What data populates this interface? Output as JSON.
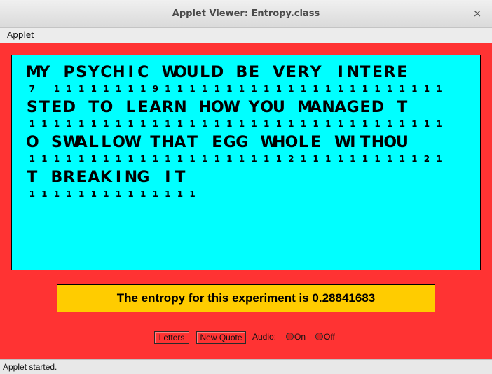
{
  "window": {
    "title": "Applet Viewer: Entropy.class",
    "close_symbol": "×"
  },
  "menu": {
    "items": [
      "Applet"
    ]
  },
  "quote_lines": [
    {
      "text": "MY PSYCHIC WOULD BE VERY INTERE",
      "counts": [
        "7",
        "",
        "1",
        "1",
        "1",
        "1",
        "1",
        "1",
        "1",
        "1",
        "9",
        "1",
        "1",
        "1",
        "1",
        "1",
        "1",
        "1",
        "1",
        "1",
        "1",
        "1",
        "1",
        "1",
        "1",
        "1",
        "1",
        "1",
        "1",
        "1",
        "1",
        "1",
        "1",
        "1"
      ]
    },
    {
      "text": "STED TO LEARN HOW YOU MANAGED T",
      "counts": [
        "1",
        "1",
        "1",
        "1",
        "1",
        "1",
        "1",
        "1",
        "1",
        "1",
        "1",
        "1",
        "1",
        "1",
        "1",
        "1",
        "1",
        "1",
        "1",
        "1",
        "1",
        "1",
        "1",
        "1",
        "1",
        "1",
        "1",
        "1",
        "1",
        "1",
        "1",
        "1",
        "1",
        "1"
      ]
    },
    {
      "text": "O SWALLOW THAT EGG WHOLE WITHOU",
      "counts": [
        "1",
        "1",
        "1",
        "1",
        "1",
        "1",
        "1",
        "1",
        "1",
        "1",
        "1",
        "1",
        "1",
        "1",
        "1",
        "1",
        "1",
        "1",
        "1",
        "1",
        "1",
        "2",
        "1",
        "1",
        "1",
        "1",
        "1",
        "1",
        "1",
        "1",
        "1",
        "1",
        "2",
        "1"
      ]
    },
    {
      "text": "T BREAKING IT",
      "counts": [
        "1",
        "1",
        "1",
        "1",
        "1",
        "1",
        "1",
        "1",
        "1",
        "1",
        "1",
        "1",
        "1",
        "1"
      ]
    }
  ],
  "entropy_text": "The entropy for this experiment is 0.28841683",
  "controls": {
    "letters_label": "Letters",
    "new_quote_label": "New Quote",
    "audio_label": "Audio:",
    "audio_on_label": "On",
    "audio_off_label": "Off"
  },
  "status": "Applet started.",
  "colors": {
    "applet_bg": "#ff3333",
    "quote_bg": "#00ffff",
    "entropy_bg": "#ffcc00"
  }
}
